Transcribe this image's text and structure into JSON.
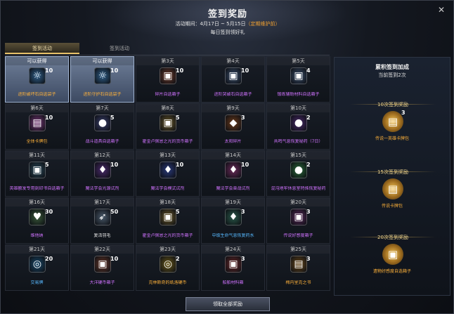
{
  "header": {
    "title": "签到奖励",
    "period_prefix": "活动期间：4月17日 ~ 5月15日",
    "period_note": "（定期维护前）",
    "subtitle": "每日签到领好礼"
  },
  "tabs": [
    {
      "label": "签到活动"
    },
    {
      "label": "签到活动"
    }
  ],
  "colors": {
    "accent": "#e9c36a",
    "orange_item": "#ffb23a",
    "purple_item": "#d073ff",
    "blue_item": "#57b9ff"
  },
  "days": [
    {
      "day": "可以获得",
      "count": "10",
      "name": "进阶破坏石自选袋子",
      "color": "orange",
      "icon": "☼",
      "icon_name": "bag-icon",
      "claimable": true,
      "bg": "#2f5f8a"
    },
    {
      "day": "可以获得",
      "count": "10",
      "name": "进阶守护石自选袋子",
      "color": "orange",
      "icon": "☼",
      "icon_name": "bag-icon",
      "claimable": true,
      "bg": "#2f5f8a"
    },
    {
      "day": "第3天",
      "count": "10",
      "name": "碎片自选箱子",
      "color": "purple",
      "icon": "▣",
      "icon_name": "chest-icon",
      "claimable": false,
      "bg": "#6b3a2a"
    },
    {
      "day": "第4天",
      "count": "10",
      "name": "进阶突破石自选箱子",
      "color": "purple",
      "icon": "▣",
      "icon_name": "chest-icon",
      "claimable": false,
      "bg": "#3a4e6b"
    },
    {
      "day": "第5天",
      "count": "4",
      "name": "锻练辅助材料自选箱子",
      "color": "purple",
      "icon": "▣",
      "icon_name": "chest-icon",
      "claimable": false,
      "bg": "#3a4e6b"
    },
    {
      "day": "第6天",
      "count": "10",
      "name": "全体卡牌包",
      "color": "orange",
      "icon": "▤",
      "icon_name": "card-pack-icon",
      "claimable": false,
      "bg": "#7a3a7a"
    },
    {
      "day": "第7天",
      "count": "5",
      "name": "战斗道具自选箱子",
      "color": "purple",
      "icon": "●",
      "icon_name": "potion-bag-icon",
      "claimable": false,
      "bg": "#3a3f6b"
    },
    {
      "day": "第8天",
      "count": "5",
      "name": "霍金卢佩恩之光的货币箱子",
      "color": "purple",
      "icon": "▣",
      "icon_name": "chest-icon",
      "claimable": false,
      "bg": "#6b5a2a"
    },
    {
      "day": "第9天",
      "count": "3",
      "name": "太阳碎片",
      "color": "purple",
      "icon": "◆",
      "icon_name": "crystal-icon",
      "claimable": false,
      "bg": "#6b3a1a"
    },
    {
      "day": "第10天",
      "count": "2",
      "name": "共鸣气息恢复秘药（7日）",
      "color": "purple",
      "icon": "●",
      "icon_name": "potion-icon",
      "claimable": false,
      "bg": "#4a2a6b"
    },
    {
      "day": "第11天",
      "count": "5",
      "name": "英雄额发专用刻印书自选箱子",
      "color": "purple",
      "icon": "▣",
      "icon_name": "chest-icon",
      "claimable": false,
      "bg": "#2a4a5a"
    },
    {
      "day": "第12天",
      "count": "10",
      "name": "魔法学会光源试剂",
      "color": "purple",
      "icon": "♦",
      "icon_name": "flask-icon",
      "claimable": false,
      "bg": "#4a2a6b"
    },
    {
      "day": "第13天",
      "count": "10",
      "name": "魔法学会模式试剂",
      "color": "purple",
      "icon": "♦",
      "icon_name": "flask-icon",
      "claimable": false,
      "bg": "#2a3a7a"
    },
    {
      "day": "第14天",
      "count": "10",
      "name": "魔法学会奋战试剂",
      "color": "purple",
      "icon": "♦",
      "icon_name": "flask-icon",
      "claimable": false,
      "bg": "#6b2a5a"
    },
    {
      "day": "第15天",
      "count": "2",
      "name": "混沌地牢休息室特殊恢复秘药",
      "color": "purple",
      "icon": "●",
      "icon_name": "potion-icon",
      "claimable": false,
      "bg": "#2a6b3a"
    },
    {
      "day": "第16天",
      "count": "30",
      "name": "维他纳",
      "color": "purple",
      "icon": "♥",
      "icon_name": "heart-house-icon",
      "claimable": false,
      "bg": "#3a5a3a"
    },
    {
      "day": "第17天",
      "count": "50",
      "name": "复活羽毛",
      "color": "white",
      "icon": "➶",
      "icon_name": "feather-icon",
      "claimable": false,
      "bg": "#4a5a6b"
    },
    {
      "day": "第18天",
      "count": "5",
      "name": "霍金卢佩恩之光的货币箱子",
      "color": "purple",
      "icon": "▣",
      "icon_name": "chest-icon",
      "claimable": false,
      "bg": "#6b5a2a"
    },
    {
      "day": "第19天",
      "count": "3",
      "name": "中级生命气息恢复药水",
      "color": "blue",
      "icon": "♦",
      "icon_name": "flask-icon",
      "claimable": false,
      "bg": "#2a5a4a"
    },
    {
      "day": "第20天",
      "count": "3",
      "name": "传说好感度箱子",
      "color": "purple",
      "icon": "▣",
      "icon_name": "chest-icon",
      "claimable": false,
      "bg": "#5a2a5a"
    },
    {
      "day": "第21天",
      "count": "20",
      "name": "交易牌",
      "color": "blue",
      "icon": "◎",
      "icon_name": "coin-icon",
      "claimable": false,
      "bg": "#1a4a6b"
    },
    {
      "day": "第22天",
      "count": "10",
      "name": "大洋硬币箱子",
      "color": "purple",
      "icon": "▣",
      "icon_name": "chest-icon",
      "claimable": false,
      "bg": "#6b3a2a"
    },
    {
      "day": "第23天",
      "count": "2",
      "name": "克林斯奇的纸洛硬币",
      "color": "orange",
      "icon": "◎",
      "icon_name": "coin-icon",
      "claimable": false,
      "bg": "#6b5a1a"
    },
    {
      "day": "第24天",
      "count": "3",
      "name": "船舶材料箱",
      "color": "purple",
      "icon": "▣",
      "icon_name": "chest-icon",
      "claimable": false,
      "bg": "#6b2a2a"
    },
    {
      "day": "第25天",
      "count": "3",
      "name": "梅内里克之书",
      "color": "orange",
      "icon": "▤",
      "icon_name": "book-icon",
      "claimable": false,
      "bg": "#6b4a1a"
    }
  ],
  "side": {
    "title": "累积签到加成",
    "count_text": "当前签到2次",
    "milestones": [
      {
        "head": "10次签到奖励",
        "count": "3",
        "name": "传说一英雄卡牌包",
        "icon": "▤"
      },
      {
        "head": "15次签到奖励",
        "count": "",
        "name": "传说卡牌包",
        "icon": "▤"
      },
      {
        "head": "20次签到奖励",
        "count": "",
        "name": "遗物好感度自选箱子",
        "icon": "▣"
      }
    ]
  },
  "footer": {
    "claim_all": "领取全部奖励"
  }
}
